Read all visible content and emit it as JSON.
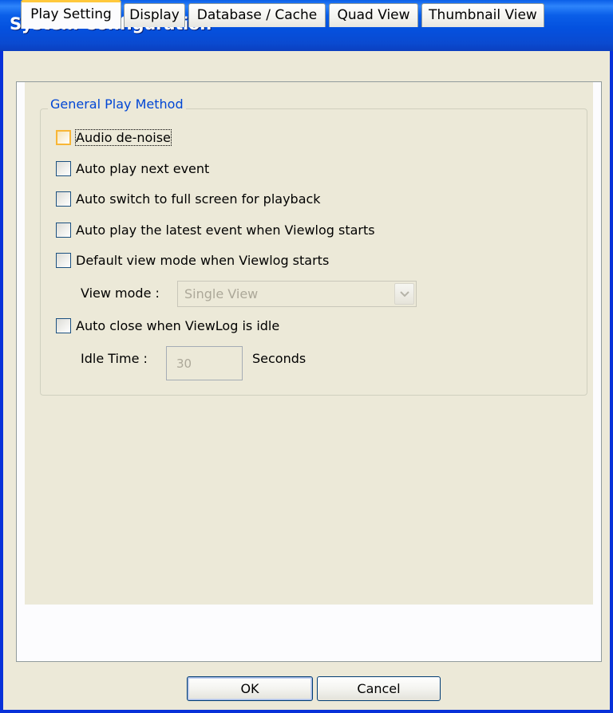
{
  "window": {
    "title": "System Configuration"
  },
  "tabs": [
    {
      "label": "Play Setting",
      "active": true
    },
    {
      "label": "Display",
      "active": false
    },
    {
      "label": "Database / Cache",
      "active": false
    },
    {
      "label": "Quad View",
      "active": false
    },
    {
      "label": "Thumbnail View",
      "active": false
    }
  ],
  "group": {
    "title": "General Play Method",
    "options": [
      {
        "label": "Audio de-noise",
        "checked": false,
        "focused": true
      },
      {
        "label": "Auto play next event",
        "checked": false
      },
      {
        "label": "Auto switch to full screen for playback",
        "checked": false
      },
      {
        "label": "Auto play the latest event when Viewlog starts",
        "checked": false
      },
      {
        "label": "Default view mode when Viewlog starts",
        "checked": false
      },
      {
        "label": "Auto close when ViewLog is idle",
        "checked": false
      }
    ],
    "view_mode": {
      "label": "View mode :",
      "value": "Single View",
      "disabled": true
    },
    "idle_time": {
      "label": "Idle Time :",
      "value": "30",
      "unit": "Seconds",
      "disabled": true
    }
  },
  "buttons": {
    "ok": "OK",
    "cancel": "Cancel"
  },
  "colors": {
    "title_bar": "#0a5ee8",
    "group_title": "#0046d5",
    "focus_highlight": "#f8b636",
    "tab_active_accent": "#ffc83c"
  },
  "icons": {
    "dropdown": "chevron-down-icon"
  }
}
